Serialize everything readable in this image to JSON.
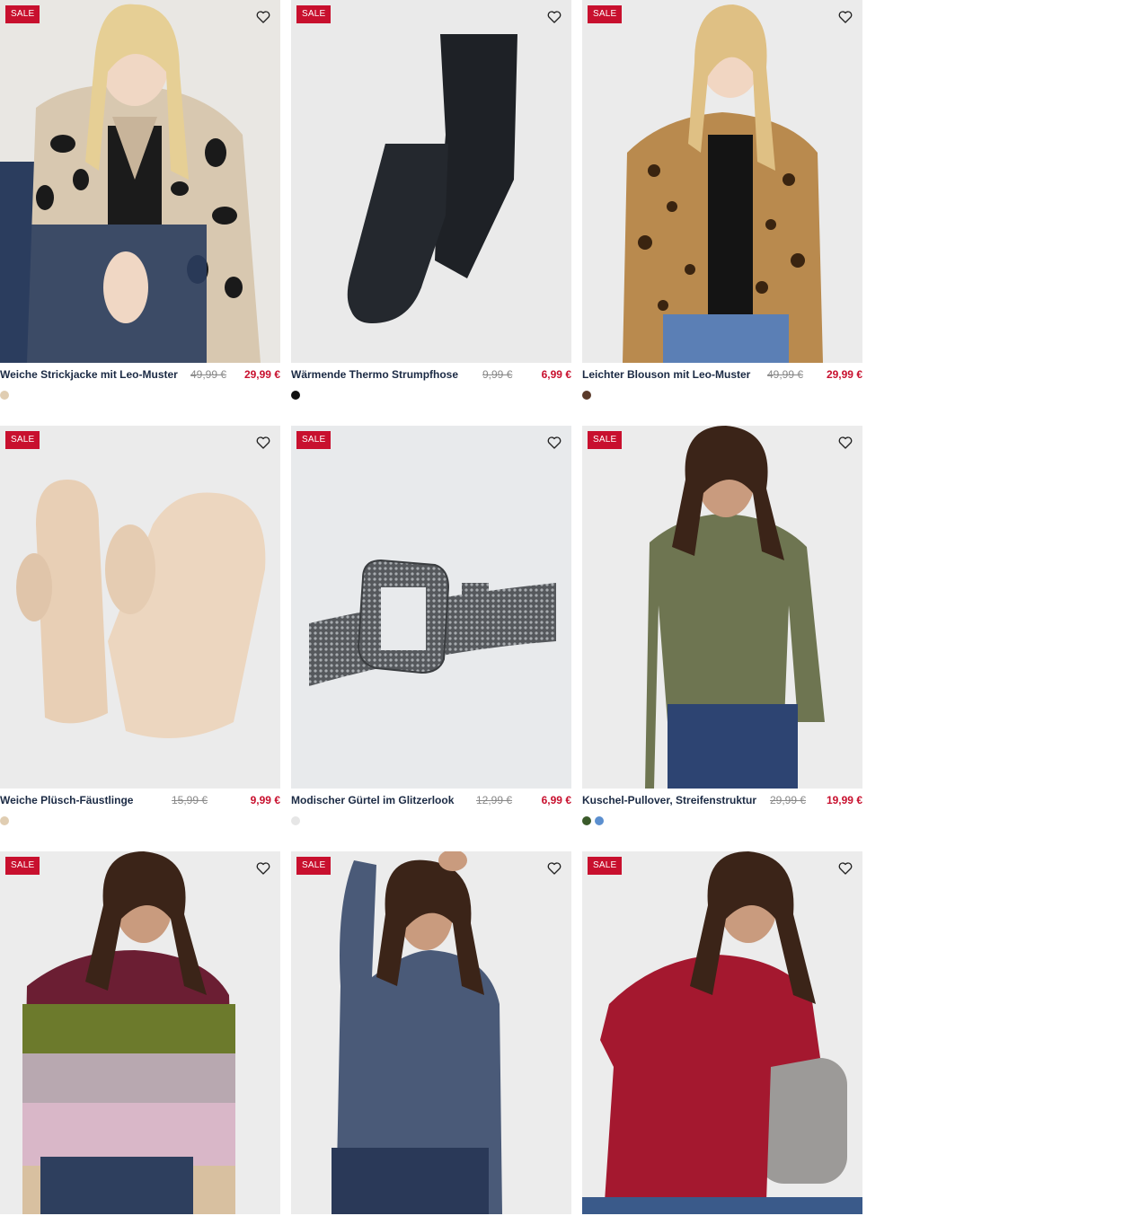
{
  "colors": {
    "sale_bg": "#c8102e",
    "title": "#1b2a44",
    "price_new": "#c8102e",
    "price_old": "#888888"
  },
  "products": [
    {
      "badge": "SALE",
      "title": "Weiche Strickjacke mit Leo-Muster",
      "old_price": "49,99 €",
      "new_price": "29,99 €",
      "swatches": [
        "#e0cdb2"
      ]
    },
    {
      "badge": "SALE",
      "title": "Wärmende Thermo Strumpfhose",
      "old_price": "9,99 €",
      "new_price": "6,99 €",
      "swatches": [
        "#111111"
      ]
    },
    {
      "badge": "SALE",
      "title": "Leichter Blouson mit Leo-Muster",
      "old_price": "49,99 €",
      "new_price": "29,99 €",
      "swatches": [
        "#5a3a2a"
      ]
    },
    {
      "badge": "SALE",
      "title": "Weiche Plüsch-Fäustlinge",
      "old_price": "15,99 €",
      "new_price": "9,99 €",
      "swatches": [
        "#e0cdb2"
      ]
    },
    {
      "badge": "SALE",
      "title": "Modischer Gürtel im Glitzerlook",
      "old_price": "12,99 €",
      "new_price": "6,99 €",
      "swatches": [
        "#e6e6e6"
      ]
    },
    {
      "badge": "SALE",
      "title": "Kuschel-Pullover, Streifenstruktur",
      "old_price": "29,99 €",
      "new_price": "19,99 €",
      "swatches": [
        "#3a5a2a",
        "#5b8fcf"
      ]
    },
    {
      "badge": "SALE"
    },
    {
      "badge": "SALE"
    },
    {
      "badge": "SALE"
    }
  ]
}
